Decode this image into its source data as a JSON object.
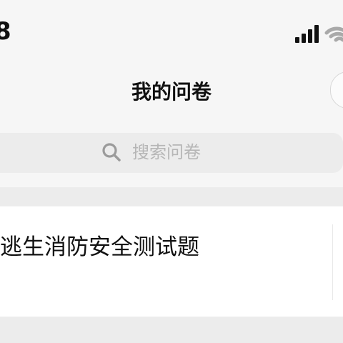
{
  "status_bar": {
    "time_fragment": "8",
    "signal_icon": "cellular-signal-icon",
    "wifi_icon": "wifi-icon"
  },
  "header": {
    "title": "我的问卷"
  },
  "search": {
    "placeholder": "搜索问卷",
    "icon": "search-icon"
  },
  "survey": {
    "title": "逃生消防安全测试题"
  }
}
